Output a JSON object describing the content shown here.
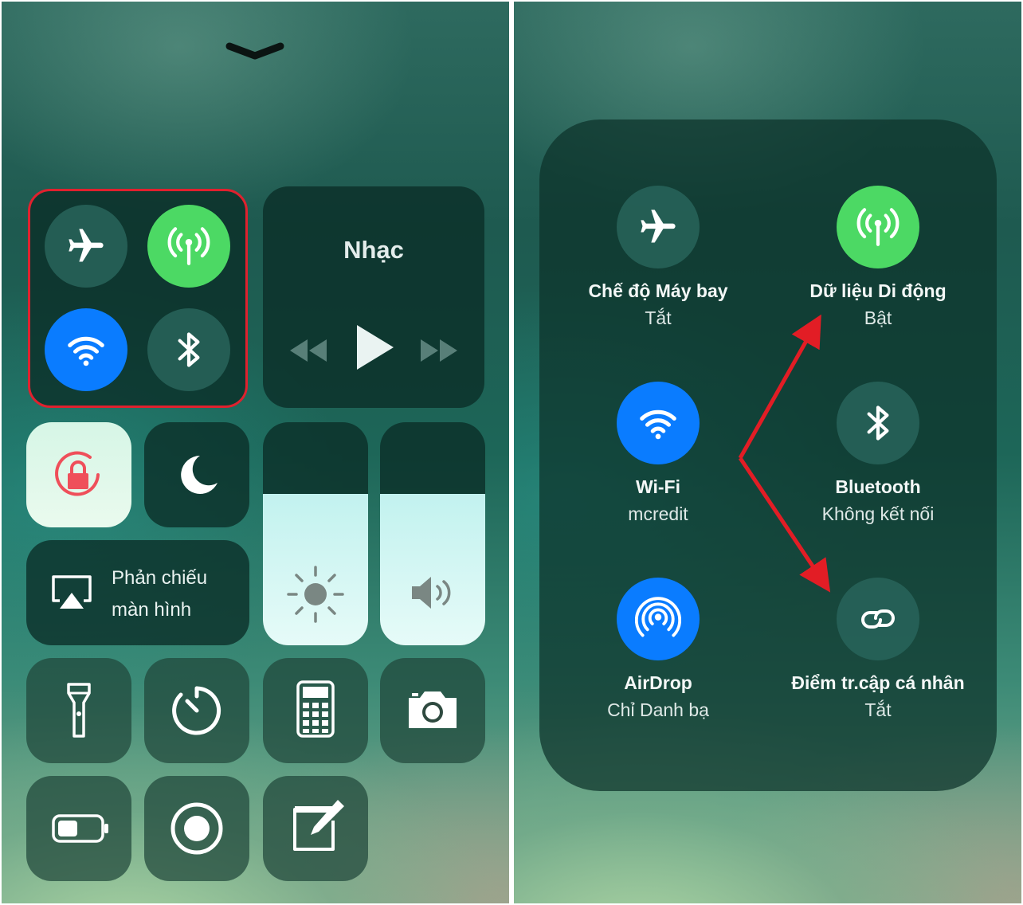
{
  "left_panel": {
    "music": {
      "title": "Nhạc"
    },
    "screen_mirroring": {
      "line1": "Phản chiếu",
      "line2": "màn hình"
    },
    "brightness_level": 0.68,
    "volume_level": 0.68
  },
  "right_panel": {
    "airplane": {
      "title": "Chế độ Máy bay",
      "status": "Tắt"
    },
    "cellular": {
      "title": "Dữ liệu Di động",
      "status": "Bật"
    },
    "wifi": {
      "title": "Wi-Fi",
      "status": "mcredit"
    },
    "bluetooth": {
      "title": "Bluetooth",
      "status": "Không kết nối"
    },
    "airdrop": {
      "title": "AirDrop",
      "status": "Chỉ Danh bạ"
    },
    "hotspot": {
      "title": "Điểm tr.cập cá nhân",
      "status": "Tắt"
    }
  },
  "colors": {
    "green": "#4cd964",
    "blue": "#0a7cff",
    "highlight_red": "#e0212e"
  }
}
